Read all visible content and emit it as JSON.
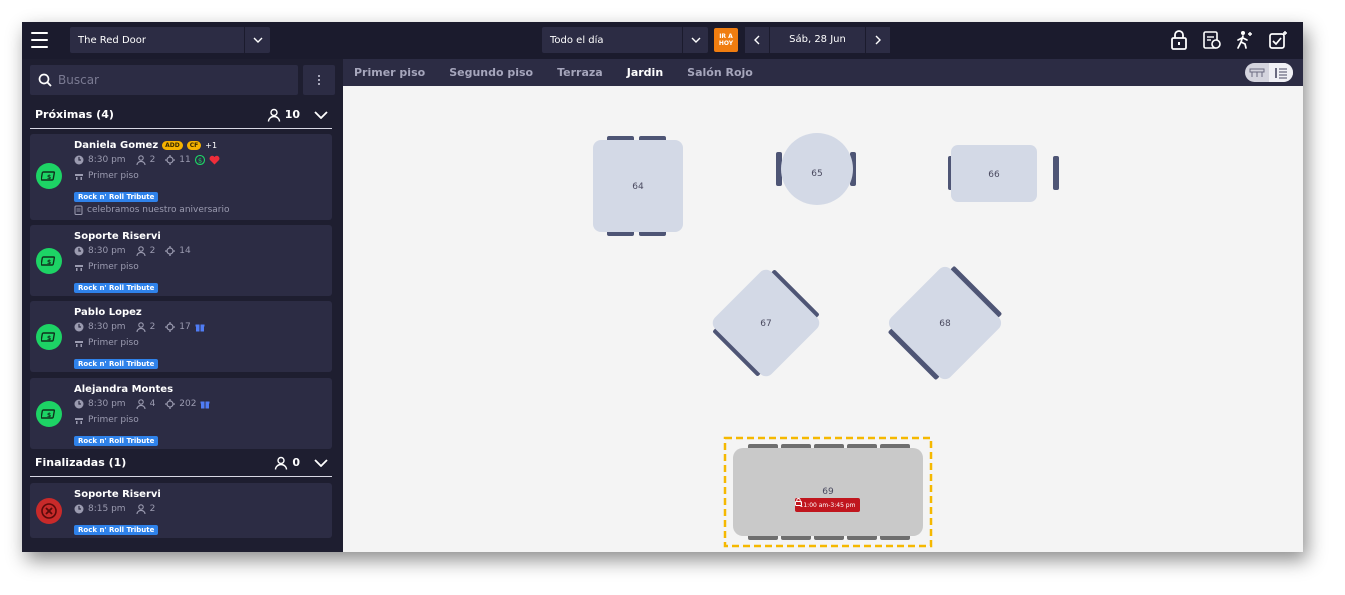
{
  "header": {
    "restaurant": "The Red Door",
    "shift": "Todo el día",
    "today_button": "IR A HOY",
    "date": "Sáb, 28 Jun"
  },
  "sidebar": {
    "search_placeholder": "Buscar",
    "upcoming": {
      "title": "Próximas (4)",
      "guests": "10"
    },
    "finished": {
      "title": "Finalizadas (1)",
      "guests": "0"
    },
    "reservations": [
      {
        "name": "Daniela Gomez",
        "badges": [
          "ADD",
          "CF"
        ],
        "extra": "+1",
        "time": "8:30 pm",
        "party": "2",
        "table": "11",
        "area": "Primer piso",
        "event": "Rock n' Roll Tribute",
        "note": "celebramos nuestro aniversario"
      },
      {
        "name": "Soporte Riservi",
        "time": "8:30 pm",
        "party": "2",
        "table": "14",
        "area": "Primer piso",
        "event": "Rock n' Roll Tribute"
      },
      {
        "name": "Pablo Lopez",
        "time": "8:30 pm",
        "party": "2",
        "table": "17",
        "area": "Primer piso",
        "event": "Rock n' Roll Tribute"
      },
      {
        "name": "Alejandra Montes",
        "time": "8:30 pm",
        "party": "4",
        "table": "202",
        "area": "Primer piso",
        "event": "Rock n' Roll Tribute"
      }
    ],
    "finished_reservations": [
      {
        "name": "Soporte Riservi",
        "time": "8:15 pm",
        "party": "2",
        "event": "Rock n' Roll Tribute"
      }
    ]
  },
  "floor": {
    "tabs": [
      "Primer piso",
      "Segundo piso",
      "Terraza",
      "Jardin",
      "Salón Rojo"
    ],
    "active_tab": "Jardin",
    "tables": {
      "t64": "64",
      "t65": "65",
      "t66": "66",
      "t67": "67",
      "t68": "68",
      "t69": "69"
    },
    "blocked_time": "11:00 am-3:45 pm"
  },
  "colors": {
    "accent_orange": "#f07d10",
    "event_tag": "#2f82ea",
    "status_ok": "#1dd365",
    "status_done": "#c82a2a",
    "selection": "#f5b800",
    "table_fill": "#d3d9e6",
    "chair": "#4e5575"
  }
}
